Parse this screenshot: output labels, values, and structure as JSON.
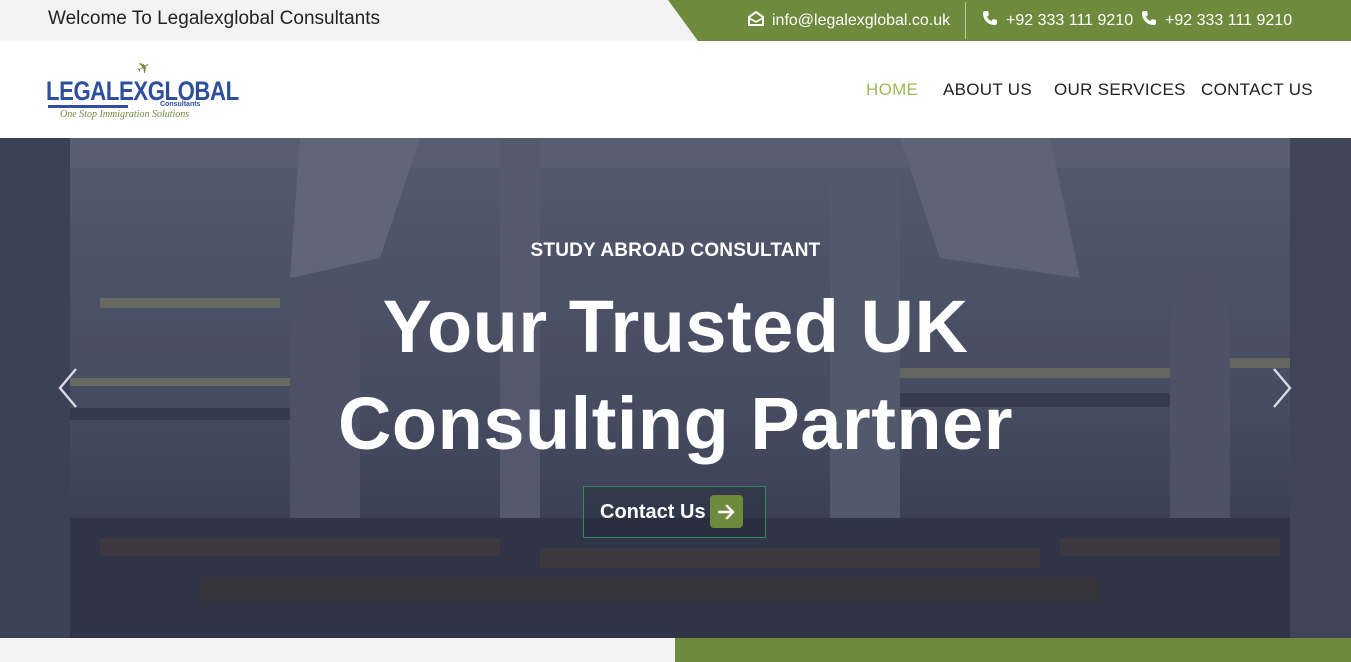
{
  "topbar": {
    "welcome": "Welcome To Legalexglobal Consultants",
    "email": "info@legalexglobal.co.uk",
    "phone_1": "+92 333 111 9210",
    "phone_2": "+92 333 111 9210",
    "accent_color": "#6e8a3d"
  },
  "logo": {
    "brand": "LEGALEXGLOBAL",
    "sub": "Consultants",
    "tagline": "One Stop Immigration Solutions"
  },
  "nav": {
    "items": [
      {
        "label": "HOME",
        "active": true
      },
      {
        "label": "ABOUT US",
        "active": false
      },
      {
        "label": "OUR SERVICES",
        "active": false
      },
      {
        "label": "CONTACT US",
        "active": false
      }
    ],
    "active_color": "#9bbb55"
  },
  "hero": {
    "eyebrow": "STUDY ABROAD CONSULTANT",
    "title_line_1": "Your Trusted UK",
    "title_line_2": "Consulting Partner",
    "cta_label": "Contact Us",
    "prev_icon": "chevron-left-icon",
    "next_icon": "chevron-right-icon"
  }
}
